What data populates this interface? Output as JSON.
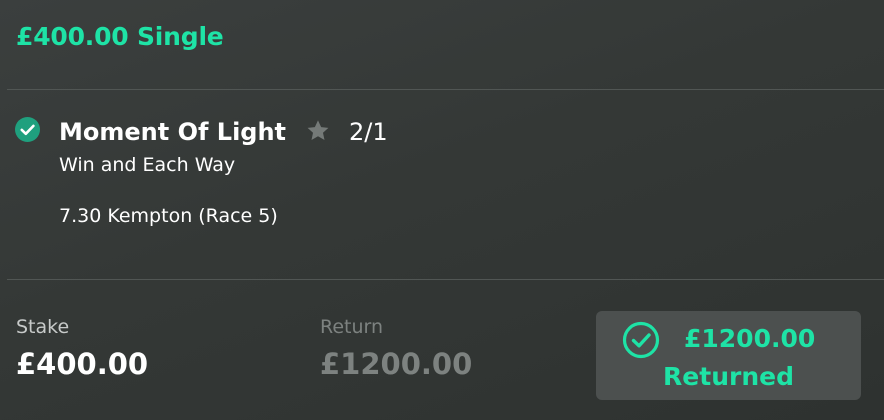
{
  "bet": {
    "title": "£400.00 Single"
  },
  "selection": {
    "status_icon": "check-circle-icon",
    "name": "Moment Of Light",
    "favourite_icon": "star-icon",
    "odds": "2/1",
    "market": "Win and Each Way",
    "event": "7.30 Kempton (Race 5)"
  },
  "summary": {
    "stake_label": "Stake",
    "stake_value": "£400.00",
    "return_label": "Return",
    "return_value": "£1200.00"
  },
  "returned": {
    "icon": "check-circle-outline-icon",
    "amount": "£1200.00",
    "label": "Returned"
  },
  "colors": {
    "accent": "#1ee3a6",
    "background": "#363a39",
    "muted_text": "#7d8280",
    "badge_background": "#4c504f",
    "check_fill": "#1fa07e"
  }
}
